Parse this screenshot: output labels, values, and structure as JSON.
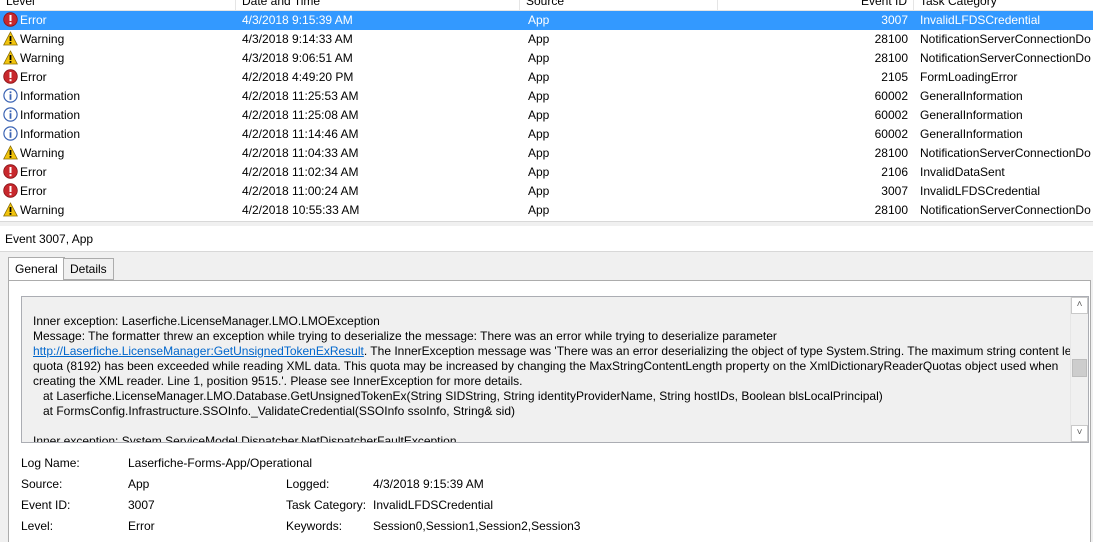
{
  "columns": {
    "level": "Level",
    "date": "Date and Time",
    "source": "Source",
    "event_id": "Event ID",
    "task": "Task Category"
  },
  "events": [
    {
      "level": "Error",
      "icon": "error-icon",
      "date": "4/3/2018 9:15:39 AM",
      "source": "App",
      "id": "3007",
      "task": "InvalidLFDSCredential",
      "selected": true
    },
    {
      "level": "Warning",
      "icon": "warning-icon",
      "date": "4/3/2018 9:14:33 AM",
      "source": "App",
      "id": "28100",
      "task": "NotificationServerConnectionDo"
    },
    {
      "level": "Warning",
      "icon": "warning-icon",
      "date": "4/3/2018 9:06:51 AM",
      "source": "App",
      "id": "28100",
      "task": "NotificationServerConnectionDo"
    },
    {
      "level": "Error",
      "icon": "error-icon",
      "date": "4/2/2018 4:49:20 PM",
      "source": "App",
      "id": "2105",
      "task": "FormLoadingError"
    },
    {
      "level": "Information",
      "icon": "info-icon",
      "date": "4/2/2018 11:25:53 AM",
      "source": "App",
      "id": "60002",
      "task": "GeneralInformation"
    },
    {
      "level": "Information",
      "icon": "info-icon",
      "date": "4/2/2018 11:25:08 AM",
      "source": "App",
      "id": "60002",
      "task": "GeneralInformation"
    },
    {
      "level": "Information",
      "icon": "info-icon",
      "date": "4/2/2018 11:14:46 AM",
      "source": "App",
      "id": "60002",
      "task": "GeneralInformation"
    },
    {
      "level": "Warning",
      "icon": "warning-icon",
      "date": "4/2/2018 11:04:33 AM",
      "source": "App",
      "id": "28100",
      "task": "NotificationServerConnectionDo"
    },
    {
      "level": "Error",
      "icon": "error-icon",
      "date": "4/2/2018 11:02:34 AM",
      "source": "App",
      "id": "2106",
      "task": "InvalidDataSent"
    },
    {
      "level": "Error",
      "icon": "error-icon",
      "date": "4/2/2018 11:00:24 AM",
      "source": "App",
      "id": "3007",
      "task": "InvalidLFDSCredential"
    },
    {
      "level": "Warning",
      "icon": "warning-icon",
      "date": "4/2/2018 10:55:33 AM",
      "source": "App",
      "id": "28100",
      "task": "NotificationServerConnectionDo"
    }
  ],
  "details": {
    "title": "Event 3007, App",
    "tabs": [
      "General",
      "Details"
    ],
    "message": {
      "line_inner": "Inner exception: Laserfiche.LicenseManager.LMO.LMOException",
      "line_msg": "Message: The formatter threw an exception while trying to deserialize the message: There was an error while trying to deserialize parameter",
      "link": "http://Laserfiche.LicenseManager:GetUnsignedTokenExResult",
      "line_link_rest": ". The InnerException message was 'There was an error deserializing the object of type System.String. The maximum string content length",
      "line_quota": "quota (8192) has been exceeded while reading XML data. This quota may be increased by changing the MaxStringContentLength property on the XmlDictionaryReaderQuotas object used when",
      "line_creating": "creating the XML reader. Line 1, position 9515.'.  Please see InnerException for more details.",
      "line_at1": "   at Laserfiche.LicenseManager.LMO.Database.GetUnsignedTokenEx(String SIDString, String identityProviderName, String hostIDs, Boolean blsLocalPrincipal)",
      "line_at2": "   at FormsConfig.Infrastructure.SSOInfo._ValidateCredential(SSOInfo ssoInfo, String& sid)",
      "line_next": "Inner exception: System.ServiceModel.Dispatcher.NetDispatcherFaultException"
    },
    "props": {
      "log_name_label": "Log Name:",
      "log_name": "Laserfiche-Forms-App/Operational",
      "source_label": "Source:",
      "source": "App",
      "logged_label": "Logged:",
      "logged": "4/3/2018 9:15:39 AM",
      "event_id_label": "Event ID:",
      "event_id": "3007",
      "task_label": "Task Category:",
      "task": "InvalidLFDSCredential",
      "level_label": "Level:",
      "level": "Error",
      "keywords_label": "Keywords:",
      "keywords": "Session0,Session1,Session2,Session3"
    }
  },
  "colors": {
    "selection": "#3399ff",
    "link": "#0066cc",
    "error": "#c8282d",
    "warning": "#f2c40c",
    "info": "#3c64b4"
  }
}
